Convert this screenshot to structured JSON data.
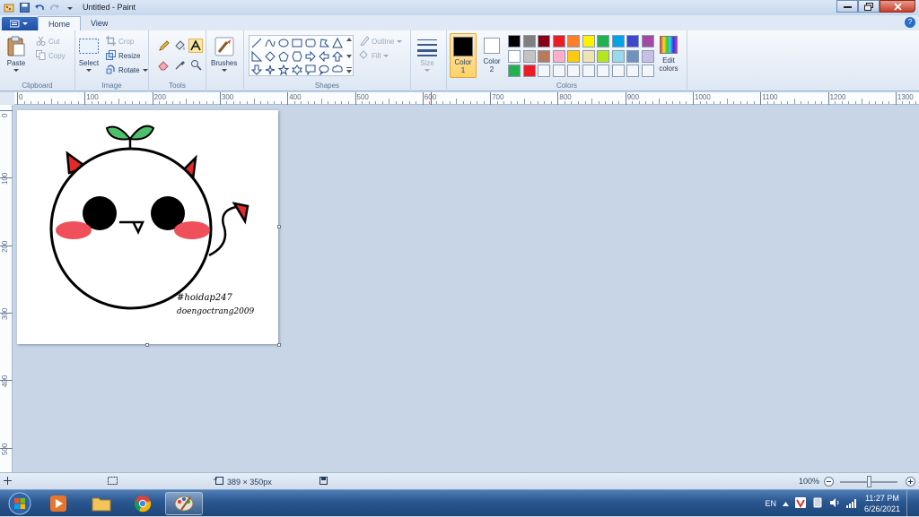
{
  "window": {
    "title": "Untitled - Paint"
  },
  "tabs": [
    {
      "label": "Home",
      "active": true
    },
    {
      "label": "View",
      "active": false
    }
  ],
  "clipboard": {
    "paste": "Paste",
    "cut": "Cut",
    "copy": "Copy",
    "group": "Clipboard"
  },
  "image": {
    "select": "Select",
    "crop": "Crop",
    "resize": "Resize",
    "rotate": "Rotate",
    "group": "Image"
  },
  "tools": {
    "group": "Tools"
  },
  "brushes": {
    "label": "Brushes"
  },
  "shapes": {
    "outline": "Outline",
    "fill": "Fill",
    "group": "Shapes"
  },
  "size": {
    "label": "Size"
  },
  "colors": {
    "color1_label": "Color 1",
    "color1_line1": "Color",
    "color1_line2": "1",
    "color2_line1": "Color",
    "color2_line2": "2",
    "edit_line1": "Edit",
    "edit_line2": "colors",
    "group": "Colors",
    "color1": "#000000",
    "color2": "#ffffff",
    "palette_row1": [
      "#000000",
      "#7f7f7f",
      "#880015",
      "#ed1c24",
      "#ff7f27",
      "#fff200",
      "#22b14c",
      "#00a2e8",
      "#3f48cc",
      "#a349a4"
    ],
    "palette_row2": [
      "#ffffff",
      "#c3c3c3",
      "#b97a57",
      "#ffaec9",
      "#ffc90e",
      "#efe4b0",
      "#b5e61d",
      "#99d9ea",
      "#7092be",
      "#c8bfe7"
    ],
    "palette_row3": [
      "#22b14c",
      "#ed1c24",
      "",
      "",
      "",
      "",
      "",
      "",
      "",
      ""
    ]
  },
  "ruler": {
    "h_labels": [
      "0",
      "100",
      "200",
      "300",
      "400",
      "500",
      "600",
      "700",
      "800",
      "900",
      "1000",
      "1100",
      "1200",
      "1300"
    ],
    "v_labels": [
      "0",
      "100",
      "200",
      "300",
      "400",
      "500"
    ]
  },
  "drawing": {
    "hashtag": "#hoidap247",
    "signature": "doengoctrang2009"
  },
  "status": {
    "dimensions": "389 × 350px",
    "zoom": "100%"
  },
  "taskbar": {
    "language": "EN",
    "time": "11:27 PM",
    "date": "6/26/2021"
  }
}
